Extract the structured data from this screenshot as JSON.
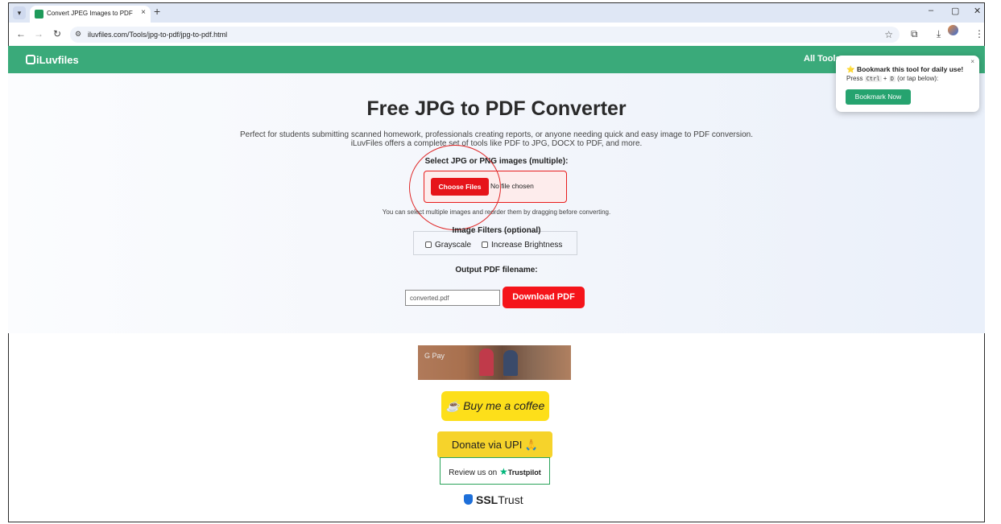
{
  "browser": {
    "tab_title": "Convert JPEG Images to PDF O",
    "tab_close": "×",
    "new_tab": "+",
    "url": "iluvfiles.com/Tools/jpg-to-pdf/jpg-to-pdf.html",
    "window_controls": {
      "minimize": "–",
      "restore": "▢",
      "close": "✕"
    }
  },
  "site": {
    "logo": "iLuvfiles",
    "nav_all_tools": "All Tools"
  },
  "main": {
    "title": "Free JPG to PDF Converter",
    "description_line1": "Perfect for students submitting scanned homework, professionals creating reports, or anyone needing quick and easy image to PDF conversion.",
    "description_line2": "iLuvFiles offers a complete set of tools like PDF to JPG, DOCX to PDF, and more.",
    "select_label": "Select JPG or PNG images (multiple):",
    "choose_files": "Choose Files",
    "no_file": "No file chosen",
    "hint": "You can select multiple images and reorder them by dragging before converting.",
    "filters_label": "Image Filters (optional)",
    "filter_grayscale": "Grayscale",
    "filter_brightness": "Increase Brightness",
    "output_label": "Output PDF filename:",
    "filename_value": "converted.pdf",
    "download_button": "Download PDF"
  },
  "popup": {
    "title": "⭐ Bookmark this tool for daily use!",
    "text_prefix": "Press",
    "key_ctrl": "Ctrl",
    "plus": "+",
    "key_d": "D",
    "text_suffix": "(or tap below):",
    "button": "Bookmark Now",
    "close": "×"
  },
  "support": {
    "gpay_label": "G Pay",
    "coffee": "Buy me a coffee",
    "upi": "Donate via UPI 🙏",
    "review_prefix": "Review us on",
    "trustpilot": "Trustpilot",
    "ssl_bold": "SSL",
    "ssl_rest": "Trust"
  },
  "colors": {
    "header_green": "#3aaa7a",
    "download_red": "#f5141a",
    "bookmark_green": "#26a36f",
    "coffee_yellow": "#fddf1a"
  }
}
